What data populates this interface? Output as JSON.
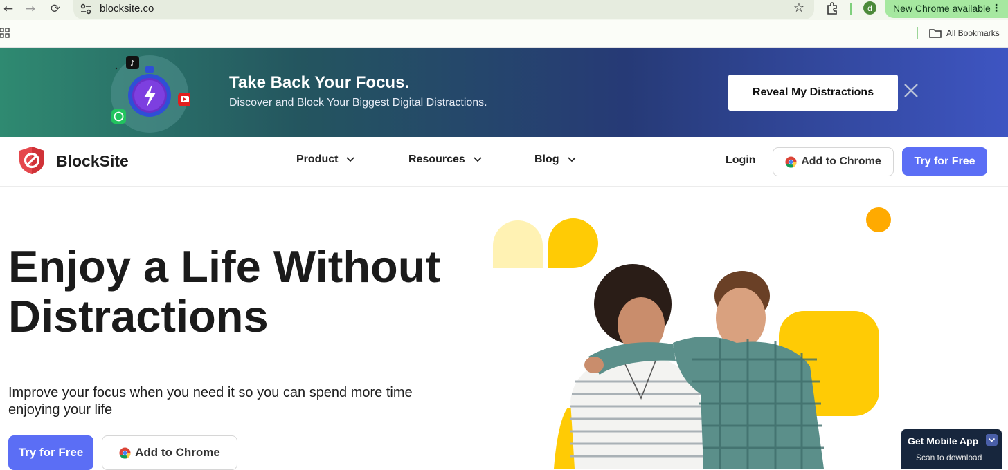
{
  "browser": {
    "url": "blocksite.co",
    "avatar_letter": "d",
    "update_label": "New Chrome available",
    "bookmarks_label": "All Bookmarks"
  },
  "banner": {
    "title": "Take Back Your Focus.",
    "subtitle": "Discover and Block Your Biggest Digital Distractions.",
    "cta_label": "Reveal My Distractions"
  },
  "header": {
    "logo_text": "BlockSite",
    "nav": [
      {
        "label": "Product"
      },
      {
        "label": "Resources"
      },
      {
        "label": "Blog"
      }
    ],
    "login_label": "Login",
    "add_chrome_label": "Add to Chrome",
    "try_free_label": "Try for Free"
  },
  "hero": {
    "title": "Enjoy a Life Without Distractions",
    "subtitle": "Improve your focus when you need it so you can spend more time enjoying your life",
    "try_free_label": "Try for Free",
    "add_chrome_label": "Add to Chrome"
  },
  "mobile_widget": {
    "title": "Get Mobile App",
    "subtitle": "Scan to download"
  },
  "colors": {
    "accent": "#5b6ef5",
    "brand_red": "#e5484d",
    "yellow": "#ffcb05",
    "widget_bg": "#17263d"
  }
}
